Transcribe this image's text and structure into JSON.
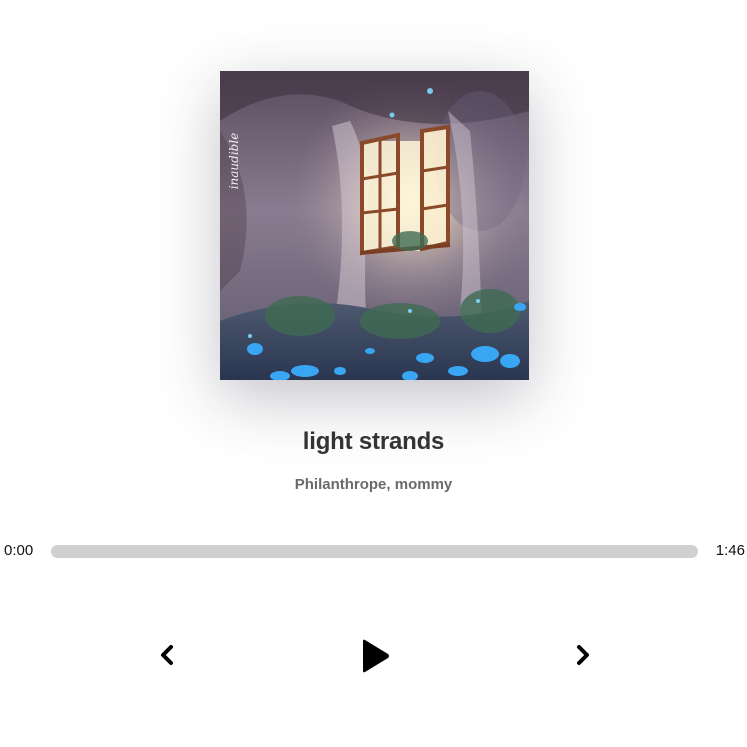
{
  "track": {
    "title": "light strands",
    "artists": "Philanthrope, mommy",
    "cover_signature": "inaudible"
  },
  "playback": {
    "current_time": "0:00",
    "total_time": "1:46",
    "progress": 0.0,
    "state": "paused"
  },
  "controls": {
    "prev_icon": "chevron-left-icon",
    "play_icon": "play-icon",
    "next_icon": "chevron-right-icon"
  },
  "colors": {
    "track_bg": "#d0d0d0",
    "text_primary": "#333333",
    "text_secondary": "#6a6a6a"
  }
}
